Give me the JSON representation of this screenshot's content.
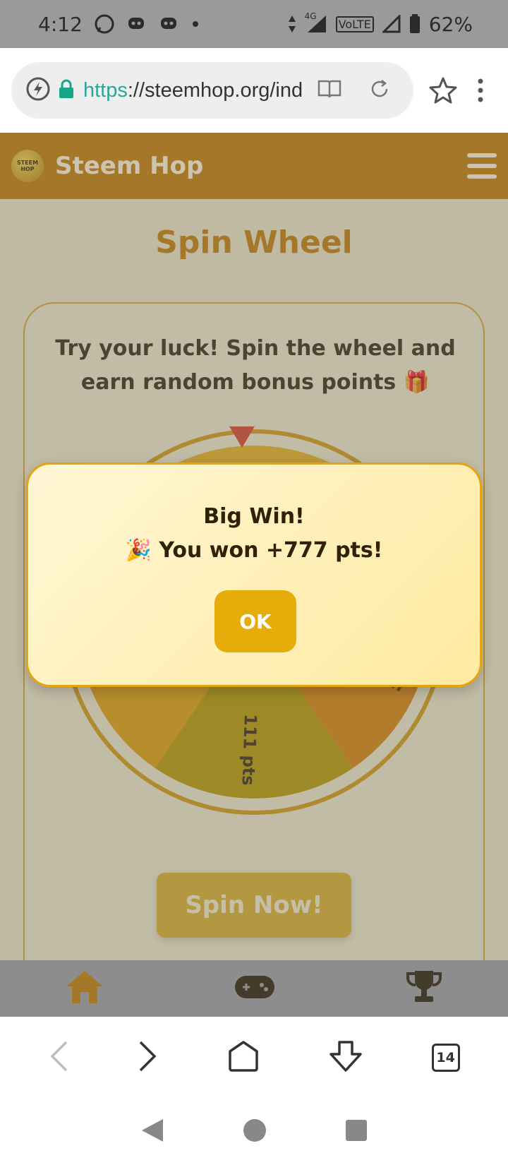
{
  "status": {
    "time": "4:12",
    "network": "4G",
    "volte": "VoLTE",
    "battery": "62%"
  },
  "browser": {
    "url_scheme": "https",
    "url_rest": "://steemhop.org/ind",
    "tab_count": "14"
  },
  "site": {
    "brand": "Steem Hop",
    "logo_text": "STEEM HOP"
  },
  "page": {
    "title": "Spin Wheel",
    "intro": "Try your luck! Spin the wheel and earn random bonus points 🎁",
    "wheel_labels": [
      "111 pts",
      "espin"
    ],
    "spin_label": "Spin Now!"
  },
  "modal": {
    "title": "Big Win!",
    "message": "🎉 You won +777 pts!",
    "ok_label": "OK"
  },
  "colors": {
    "accent": "#c47d06",
    "modal_border": "#e3a412",
    "ok_button": "#e6ac0a",
    "wheel_gold": "#e5a30c",
    "wheel_olive": "#b79800"
  }
}
